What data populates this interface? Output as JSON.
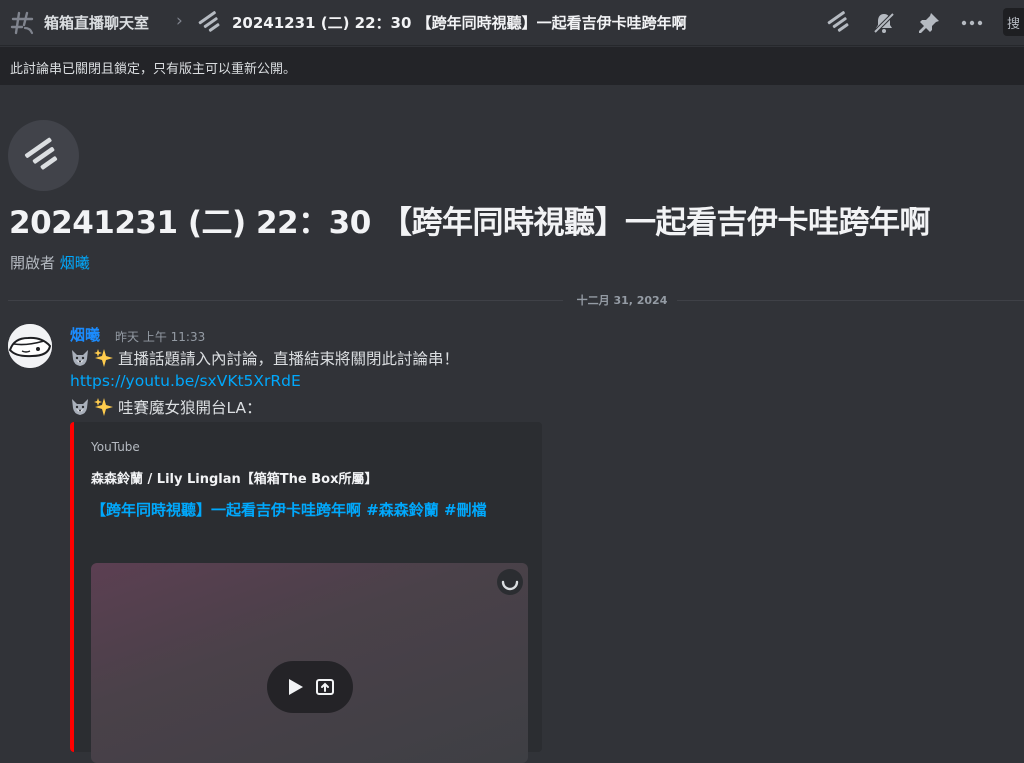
{
  "header": {
    "channel_name": "箱箱直播聊天室",
    "thread_title": "20241231 (二) 22：30 【跨年同時視聽】一起看吉伊卡哇跨年啊",
    "search_placeholder": "搜"
  },
  "notice": "此討論串已關閉且鎖定，只有版主可以重新公開。",
  "thread": {
    "title": "20241231 (二) 22：30 【跨年同時視聽】一起看吉伊卡哇跨年啊",
    "started_by_label": "開啟者",
    "started_by_user": "烟曦"
  },
  "divider_date": "十二月 31, 2024",
  "message": {
    "author": "烟曦",
    "timestamp": "昨天 上午 11:33",
    "line1": "直播話題請入內討論，直播結束將關閉此討論串！",
    "link": "https://youtu.be/sxVKt5XrRdE",
    "line3": "哇賽魔女狼開台LA："
  },
  "embed": {
    "provider": "YouTube",
    "author": "森森鈴蘭 / Lily Linglan【箱箱The Box所屬】",
    "title": "【跨年同時視聽】一起看吉伊卡哇跨年啊 #森森鈴蘭 #刪檔",
    "accent_color": "#ff0000"
  },
  "icons": [
    "hash-threads-icon",
    "thread-icon",
    "threads-icon",
    "mute-icon",
    "pin-icon",
    "more-icon",
    "wolf-emoji",
    "sparkles-emoji",
    "play-icon",
    "open-external-icon",
    "loading-spinner-icon"
  ]
}
